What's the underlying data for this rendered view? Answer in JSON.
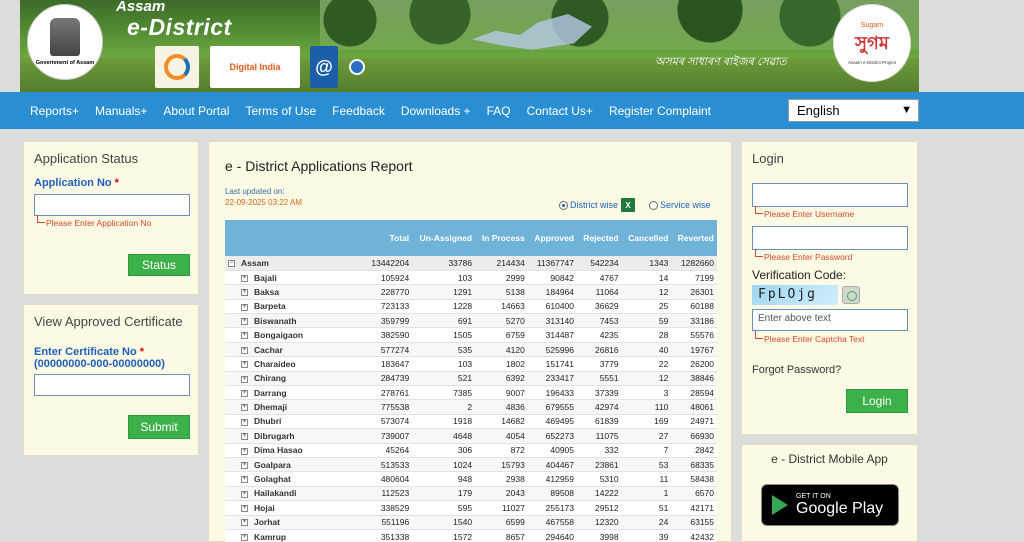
{
  "header": {
    "brand_line1": "Assam",
    "brand_line2": "e-District",
    "emblem_caption": "Government of Assam",
    "digital_india_label": "Digital India",
    "at_symbol": "@",
    "tagline": "অসমৰ সাধাৰণ ৰাইজৰ সেৱাত",
    "sugam_small": "Sugam",
    "sugam_main": "সুগম",
    "sugam_caption": "Assam e-District Project"
  },
  "nav": {
    "items": [
      "Reports+",
      "Manuals+",
      "About Portal",
      "Terms of Use",
      "Feedback",
      "Downloads +",
      "FAQ",
      "Contact Us+",
      "Register Complaint"
    ],
    "language": "English"
  },
  "app_status": {
    "title": "Application Status",
    "field_label": "Application No",
    "required_mark": "*",
    "value": "",
    "error": "Please Enter Application No",
    "button": "Status"
  },
  "cert": {
    "title": "View Approved Certificate",
    "field_label": "Enter Certificate No",
    "required_mark": "*",
    "format_hint": "(00000000-000-00000000)",
    "value": "",
    "button": "Submit"
  },
  "report": {
    "title": "e - District Applications Report",
    "updated_label": "Last updated on:",
    "updated_ts": "22-09-2025 03:22 AM",
    "radio_district": "District wise",
    "radio_service": "Service wise",
    "radio_selected": "district",
    "excel_icon": "X",
    "columns": [
      "",
      "Total",
      "Un-Assigned",
      "In Process",
      "Approved",
      "Rejected",
      "Cancelled",
      "Reverted"
    ],
    "state_row": {
      "name": "Assam",
      "values": [
        "13442204",
        "33786",
        "214434",
        "11367747",
        "542234",
        "1343",
        "1282660"
      ]
    },
    "rows": [
      {
        "name": "Bajali",
        "values": [
          "105924",
          "103",
          "2999",
          "90842",
          "4767",
          "14",
          "7199"
        ]
      },
      {
        "name": "Baksa",
        "values": [
          "228770",
          "1291",
          "5138",
          "184964",
          "11064",
          "12",
          "26301"
        ]
      },
      {
        "name": "Barpeta",
        "values": [
          "723133",
          "1228",
          "14663",
          "610400",
          "36629",
          "25",
          "60188"
        ]
      },
      {
        "name": "Biswanath",
        "values": [
          "359799",
          "691",
          "5270",
          "313140",
          "7453",
          "59",
          "33186"
        ]
      },
      {
        "name": "Bongaigaon",
        "values": [
          "382590",
          "1505",
          "6759",
          "314487",
          "4235",
          "28",
          "55576"
        ]
      },
      {
        "name": "Cachar",
        "values": [
          "577274",
          "535",
          "4120",
          "525996",
          "26816",
          "40",
          "19767"
        ]
      },
      {
        "name": "Charaideo",
        "values": [
          "183647",
          "103",
          "1802",
          "151741",
          "3779",
          "22",
          "26200"
        ]
      },
      {
        "name": "Chirang",
        "values": [
          "284739",
          "521",
          "6392",
          "233417",
          "5551",
          "12",
          "38846"
        ]
      },
      {
        "name": "Darrang",
        "values": [
          "278761",
          "7385",
          "9007",
          "196433",
          "37339",
          "3",
          "28594"
        ]
      },
      {
        "name": "Dhemaji",
        "values": [
          "775538",
          "2",
          "4836",
          "679555",
          "42974",
          "110",
          "48061"
        ]
      },
      {
        "name": "Dhubri",
        "values": [
          "573074",
          "1918",
          "14682",
          "469495",
          "61839",
          "169",
          "24971"
        ]
      },
      {
        "name": "Dibrugarh",
        "values": [
          "739007",
          "4648",
          "4054",
          "652273",
          "11075",
          "27",
          "66930"
        ]
      },
      {
        "name": "Dima Hasao",
        "values": [
          "45264",
          "306",
          "872",
          "40905",
          "332",
          "7",
          "2842"
        ]
      },
      {
        "name": "Goalpara",
        "values": [
          "513533",
          "1024",
          "15793",
          "404467",
          "23861",
          "53",
          "68335"
        ]
      },
      {
        "name": "Golaghat",
        "values": [
          "480604",
          "948",
          "2938",
          "412959",
          "5310",
          "11",
          "58438"
        ]
      },
      {
        "name": "Hailakandi",
        "values": [
          "112523",
          "179",
          "2043",
          "89508",
          "14222",
          "1",
          "6570"
        ]
      },
      {
        "name": "Hojai",
        "values": [
          "338529",
          "595",
          "11027",
          "255173",
          "29512",
          "51",
          "42171"
        ]
      },
      {
        "name": "Jorhat",
        "values": [
          "551196",
          "1540",
          "6599",
          "467558",
          "12320",
          "24",
          "63155"
        ]
      },
      {
        "name": "Kamrup",
        "values": [
          "351338",
          "1572",
          "8657",
          "294640",
          "3998",
          "39",
          "42432"
        ]
      }
    ]
  },
  "login": {
    "title": "Login",
    "username_value": "",
    "username_error": "Please Enter Username",
    "password_value": "",
    "password_error": "Please Enter Password",
    "verification_label": "Verification Code:",
    "captcha_text": "FpLOjg",
    "captcha_placeholder": "Enter above text",
    "captcha_error": "Please Enter Captcha Text",
    "forgot": "Forgot Password?",
    "button": "Login"
  },
  "mobile": {
    "title": "e - District Mobile App",
    "store_line1": "GET IT ON",
    "store_line2": "Google Play"
  }
}
